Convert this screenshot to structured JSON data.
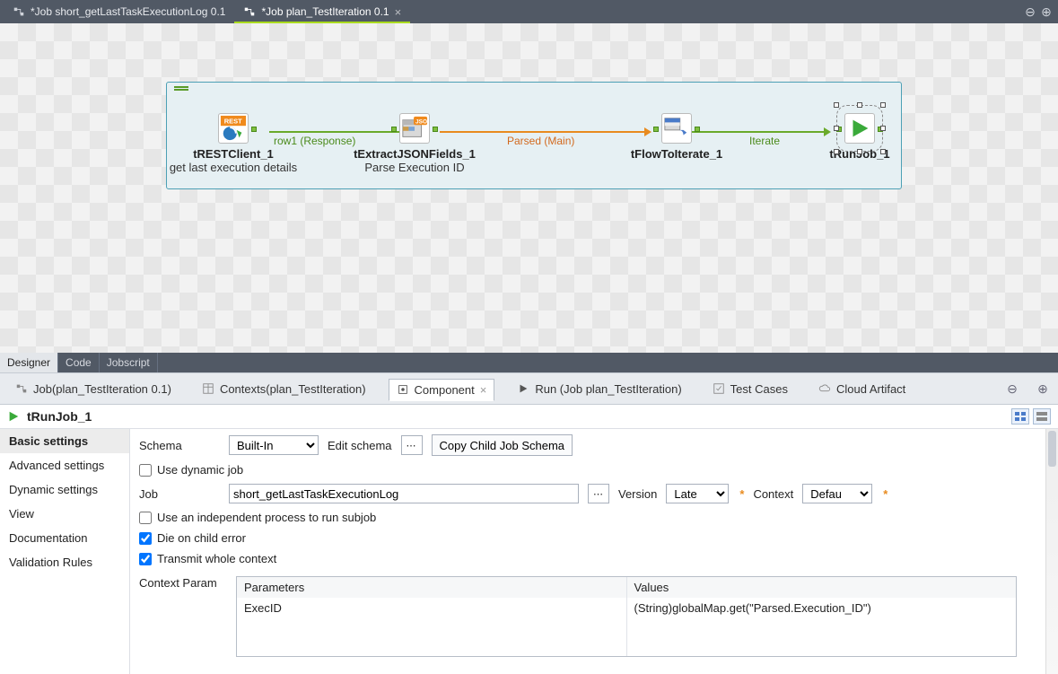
{
  "editor_tabs": {
    "inactive": "*Job short_getLastTaskExecutionLog 0.1",
    "active": "*Job plan_TestIteration 0.1"
  },
  "designer": {
    "link_labels": {
      "row1": "row1 (Response)",
      "parsed": "Parsed (Main)",
      "iterate": "Iterate"
    },
    "components": {
      "rest": {
        "title": "tRESTClient_1",
        "subtitle": "get last execution details"
      },
      "json": {
        "title": "tExtractJSONFields_1",
        "subtitle": "Parse Execution ID"
      },
      "flow": {
        "title": "tFlowToIterate_1"
      },
      "runjob": {
        "title": "tRunJob_1"
      }
    },
    "bottom_tabs": {
      "designer": "Designer",
      "code": "Code",
      "jobscript": "Jobscript"
    }
  },
  "views": {
    "job": "Job(plan_TestIteration 0.1)",
    "contexts": "Contexts(plan_TestIteration)",
    "component": "Component",
    "run": "Run (Job plan_TestIteration)",
    "tests": "Test Cases",
    "cloud": "Cloud Artifact"
  },
  "panel": {
    "header_name": "tRunJob_1",
    "nav": {
      "basic": "Basic settings",
      "advanced": "Advanced settings",
      "dynamic": "Dynamic settings",
      "view": "View",
      "doc": "Documentation",
      "validation": "Validation Rules"
    },
    "form": {
      "schema_label": "Schema",
      "schema_value": "Built-In",
      "edit_schema": "Edit schema",
      "copy_child": "Copy Child Job Schema",
      "use_dynamic": "Use dynamic job",
      "job_label": "Job",
      "job_value": "short_getLastTaskExecutionLog",
      "version_label": "Version",
      "version_value": "Latest",
      "context_label": "Context",
      "context_value": "Default",
      "independent": "Use an independent process to run subjob",
      "die_on_child": "Die on child error",
      "transmit_ctx": "Transmit whole context",
      "ctx_param_label": "Context Param",
      "table": {
        "hdr_param": "Parameters",
        "hdr_value": "Values",
        "row_param": "ExecID",
        "row_value": "(String)globalMap.get(\"Parsed.Execution_ID\")"
      }
    }
  }
}
